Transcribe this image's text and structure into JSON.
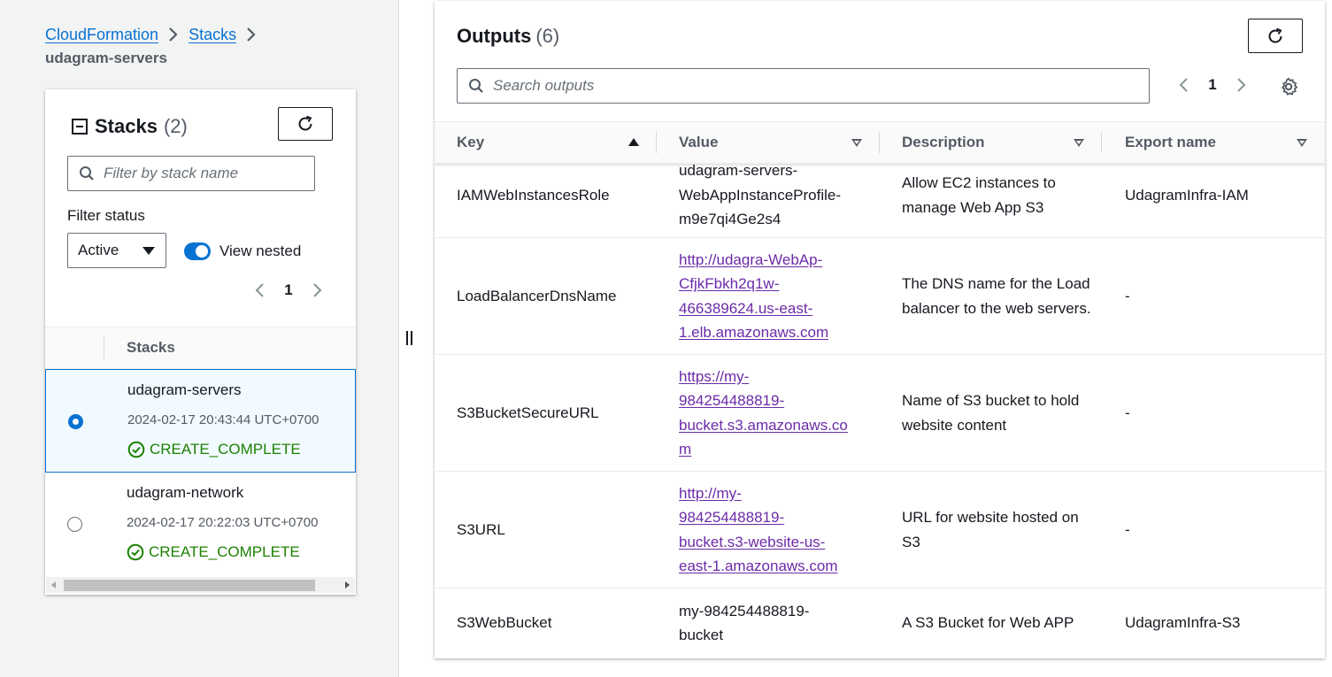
{
  "breadcrumb": {
    "items": [
      "CloudFormation",
      "Stacks"
    ],
    "current": "udagram-servers"
  },
  "stacks_panel": {
    "title": "Stacks",
    "count": "(2)",
    "filter_placeholder": "Filter by stack name",
    "filter_status_label": "Filter status",
    "status_selected": "Active",
    "view_nested_label": "View nested",
    "view_nested_on": true,
    "page": "1",
    "column_header": "Stacks",
    "rows": [
      {
        "name": "udagram-servers",
        "time": "2024-02-17 20:43:44 UTC+0700",
        "status": "CREATE_COMPLETE",
        "selected": true
      },
      {
        "name": "udagram-network",
        "time": "2024-02-17 20:22:03 UTC+0700",
        "status": "CREATE_COMPLETE",
        "selected": false
      }
    ]
  },
  "outputs_panel": {
    "title": "Outputs",
    "count": "(6)",
    "search_placeholder": "Search outputs",
    "page": "1",
    "columns": [
      "Key",
      "Value",
      "Description",
      "Export name"
    ],
    "rows": [
      {
        "key": "IAMWebInstancesRole",
        "value_lines": [
          "udagram-servers-",
          "WebAppInstanceProfile-",
          "m9e7qi4Ge2s4"
        ],
        "value_is_link": false,
        "description": "Allow EC2 instances to manage Web App S3",
        "export": "UdagramInfra-IAM"
      },
      {
        "key": "LoadBalancerDnsName",
        "value_lines": [
          "http://udagra-WebAp-",
          "CfjkFbkh2q1w-",
          "466389624.us-east-",
          "1.elb.amazonaws.com"
        ],
        "value_is_link": true,
        "description": "The DNS name for the Load balancer to the web servers.",
        "export": "-"
      },
      {
        "key": "S3BucketSecureURL",
        "value_lines": [
          "https://my-",
          "984254488819-",
          "bucket.s3.amazonaws.co",
          "m"
        ],
        "value_is_link": true,
        "description": "Name of S3 bucket to hold website content",
        "export": "-"
      },
      {
        "key": "S3URL",
        "value_lines": [
          "http://my-",
          "984254488819-",
          "bucket.s3-website-us-",
          "east-1.amazonaws.com"
        ],
        "value_is_link": true,
        "description": "URL for website hosted on S3",
        "export": "-"
      },
      {
        "key": "S3WebBucket",
        "value_lines": [
          "my-984254488819-",
          "bucket"
        ],
        "value_is_link": false,
        "description": "A S3 Bucket for Web APP",
        "export": "UdagramInfra-S3"
      }
    ]
  },
  "colors": {
    "link": "#0972d3",
    "visited_link": "#6b2aa8",
    "success": "#1d8102",
    "selected_bg": "#f1faff"
  }
}
